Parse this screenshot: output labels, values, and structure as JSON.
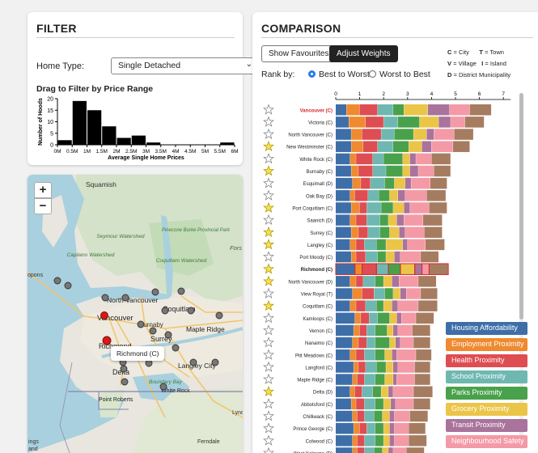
{
  "filter": {
    "title": "FILTER",
    "home_type_label": "Home Type:",
    "home_type_value": "Single Detached",
    "drag_label": "Drag to Filter by Price Range",
    "histogram": {
      "ylabel": "Number of Hoods",
      "xlabel": "Average Single Home Prices",
      "y_ticks": [
        "0",
        "5",
        "10",
        "15",
        "20"
      ],
      "x_ticks": [
        "0M",
        "0.5M",
        "1M",
        "1.5M",
        "2M",
        "2.5M",
        "3M",
        "3.5M",
        "4M",
        "4.5M",
        "5M",
        "5.5M",
        "6M"
      ],
      "counts": [
        2,
        19,
        15,
        8,
        3,
        4,
        1,
        0,
        0,
        0,
        0,
        1
      ]
    }
  },
  "map": {
    "zoom_in": "+",
    "zoom_out": "−",
    "tooltip": "Richmond (C)",
    "places": [
      {
        "name": "Squamish"
      },
      {
        "name": "North Vancouver"
      },
      {
        "name": "Vancouver"
      },
      {
        "name": "Coquitlam"
      },
      {
        "name": "Burnaby"
      },
      {
        "name": "Surrey"
      },
      {
        "name": "Maple Ridge"
      },
      {
        "name": "Richmond"
      },
      {
        "name": "Delta"
      },
      {
        "name": "Langley City"
      },
      {
        "name": "White Rock"
      },
      {
        "name": "Point Roberts"
      },
      {
        "name": "Lynde"
      },
      {
        "name": "Ferndale"
      },
      {
        "name": "Seymour Watershed"
      },
      {
        "name": "Pinecone Burke Provincial Park"
      },
      {
        "name": "Capilano Watershed"
      },
      {
        "name": "Coquitlam Watershed"
      },
      {
        "name": "Fors"
      },
      {
        "name": "opons"
      },
      {
        "name": "Boundary Bay"
      },
      {
        "name": "ings"
      },
      {
        "name": "and"
      }
    ]
  },
  "comparison": {
    "title": "COMPARISON",
    "show_favourites": "Show Favourites",
    "adjust_weights": "Adjust Weights",
    "keys": [
      {
        "code": "C",
        "text": " = City"
      },
      {
        "code": "T",
        "text": " = Town"
      },
      {
        "code": "V",
        "text": " = Village"
      },
      {
        "code": "I",
        "text": " = Island"
      },
      {
        "code": "D",
        "text": " = District Municipality"
      }
    ],
    "rank_by": "Rank by:",
    "best_to_worst": "Best to Worst",
    "worst_to_best": "Worst to Best",
    "axis_ticks": [
      "0",
      "1",
      "2",
      "3",
      "4",
      "5",
      "6",
      "7"
    ],
    "colors": {
      "housing": "#3e6ea8",
      "employment": "#ef8a30",
      "health": "#de4d52",
      "school": "#6fb8b1",
      "parks": "#4aa14b",
      "grocery": "#ebc548",
      "transit": "#a9739b",
      "safety": "#f49aa6",
      "other": "#a67c61"
    },
    "legend": [
      {
        "label": "Housing Affordability",
        "key": "housing"
      },
      {
        "label": "Employment Proximity",
        "key": "employment"
      },
      {
        "label": "Health Proximity",
        "key": "health"
      },
      {
        "label": "School Proximity",
        "key": "school"
      },
      {
        "label": "Parks Proximity",
        "key": "parks"
      },
      {
        "label": "Grocery Proximity",
        "key": "grocery"
      },
      {
        "label": "Transit Proximity",
        "key": "transit"
      },
      {
        "label": "Neighbourhood Safety",
        "key": "safety"
      }
    ]
  },
  "chart_data": {
    "type": "bar",
    "orientation": "horizontal-stacked",
    "xlim": [
      0,
      7.4
    ],
    "series_names": [
      "Housing Affordability",
      "Employment Proximity",
      "Health Proximity",
      "School Proximity",
      "Parks Proximity",
      "Grocery Proximity",
      "Transit Proximity",
      "Neighbourhood Safety",
      "Other"
    ],
    "rows": [
      {
        "name": "Vancouver (C)",
        "fav": false,
        "highlight": "red",
        "values": [
          0.45,
          0.55,
          0.75,
          0.65,
          0.45,
          1.0,
          0.9,
          0.85,
          0.9
        ]
      },
      {
        "name": "Victoria (C)",
        "fav": false,
        "values": [
          0.55,
          0.7,
          0.75,
          0.6,
          0.9,
          0.8,
          0.5,
          0.6,
          0.8
        ]
      },
      {
        "name": "North Vancouver (C)",
        "fav": false,
        "values": [
          0.65,
          0.45,
          0.8,
          0.55,
          0.8,
          0.55,
          0.3,
          0.85,
          0.8
        ]
      },
      {
        "name": "New Westminster (C)",
        "fav": true,
        "values": [
          0.65,
          0.5,
          0.6,
          0.65,
          0.65,
          0.55,
          0.4,
          0.9,
          0.7
        ]
      },
      {
        "name": "White Rock (C)",
        "fav": false,
        "values": [
          0.6,
          0.25,
          0.7,
          0.45,
          0.8,
          0.3,
          0.25,
          0.65,
          0.8
        ]
      },
      {
        "name": "Burnaby (C)",
        "fav": true,
        "values": [
          0.65,
          0.3,
          0.6,
          0.55,
          0.7,
          0.3,
          0.35,
          0.65,
          0.7
        ]
      },
      {
        "name": "Esquimalt (D)",
        "fav": false,
        "values": [
          0.7,
          0.35,
          0.4,
          0.6,
          0.4,
          0.45,
          0.25,
          0.8,
          0.7
        ]
      },
      {
        "name": "Oak Bay (D)",
        "fav": false,
        "values": [
          0.6,
          0.2,
          0.55,
          0.45,
          0.45,
          0.35,
          0.3,
          0.9,
          0.8
        ]
      },
      {
        "name": "Port Coquitlam (C)",
        "fav": true,
        "values": [
          0.65,
          0.35,
          0.3,
          0.6,
          0.5,
          0.45,
          0.25,
          0.8,
          0.75
        ]
      },
      {
        "name": "Saanich (D)",
        "fav": false,
        "values": [
          0.6,
          0.25,
          0.45,
          0.55,
          0.35,
          0.35,
          0.3,
          0.8,
          0.8
        ]
      },
      {
        "name": "Surrey (C)",
        "fav": true,
        "values": [
          0.65,
          0.3,
          0.4,
          0.5,
          0.4,
          0.4,
          0.25,
          0.8,
          0.75
        ]
      },
      {
        "name": "Langley (C)",
        "fav": true,
        "values": [
          0.6,
          0.25,
          0.35,
          0.5,
          0.4,
          0.7,
          0.2,
          0.75,
          0.8
        ]
      },
      {
        "name": "Port Moody (C)",
        "fav": false,
        "values": [
          0.65,
          0.2,
          0.4,
          0.5,
          0.35,
          0.35,
          0.25,
          0.85,
          0.75
        ]
      },
      {
        "name": "Richmond (C)",
        "fav": true,
        "bold": true,
        "values": [
          0.8,
          0.3,
          0.6,
          0.5,
          0.5,
          0.6,
          0.3,
          0.3,
          0.8
        ]
      },
      {
        "name": "North Vancouver (D)",
        "fav": true,
        "values": [
          0.6,
          0.25,
          0.3,
          0.5,
          0.35,
          0.35,
          0.3,
          0.8,
          0.75
        ]
      },
      {
        "name": "View Royal (T)",
        "fav": false,
        "values": [
          0.7,
          0.4,
          0.5,
          0.45,
          0.35,
          0.3,
          0.25,
          0.6,
          0.7
        ]
      },
      {
        "name": "Coquitlam (C)",
        "fav": true,
        "values": [
          0.6,
          0.25,
          0.4,
          0.45,
          0.3,
          0.35,
          0.25,
          0.85,
          0.8
        ]
      },
      {
        "name": "Kamloops (C)",
        "fav": false,
        "values": [
          0.8,
          0.25,
          0.35,
          0.35,
          0.5,
          0.3,
          0.2,
          0.6,
          0.75
        ]
      },
      {
        "name": "Vernon (C)",
        "fav": false,
        "values": [
          0.75,
          0.25,
          0.3,
          0.35,
          0.5,
          0.25,
          0.2,
          0.6,
          0.75
        ]
      },
      {
        "name": "Nanaimo (C)",
        "fav": false,
        "values": [
          0.7,
          0.25,
          0.35,
          0.35,
          0.6,
          0.25,
          0.2,
          0.55,
          0.7
        ]
      },
      {
        "name": "Pitt Meadows (C)",
        "fav": false,
        "values": [
          0.6,
          0.25,
          0.35,
          0.45,
          0.4,
          0.3,
          0.2,
          0.8,
          0.65
        ]
      },
      {
        "name": "Langford (C)",
        "fav": false,
        "values": [
          0.75,
          0.2,
          0.3,
          0.45,
          0.4,
          0.3,
          0.2,
          0.7,
          0.65
        ]
      },
      {
        "name": "Maple Ridge (C)",
        "fav": false,
        "values": [
          0.7,
          0.2,
          0.3,
          0.45,
          0.4,
          0.35,
          0.15,
          0.75,
          0.65
        ]
      },
      {
        "name": "Delta (D)",
        "fav": true,
        "values": [
          0.6,
          0.2,
          0.3,
          0.45,
          0.35,
          0.3,
          0.2,
          0.85,
          0.8
        ]
      },
      {
        "name": "Abbotsford (C)",
        "fav": false,
        "values": [
          0.65,
          0.2,
          0.35,
          0.45,
          0.35,
          0.3,
          0.2,
          0.75,
          0.7
        ]
      },
      {
        "name": "Chilliwack (C)",
        "fav": false,
        "values": [
          0.7,
          0.2,
          0.3,
          0.4,
          0.35,
          0.3,
          0.2,
          0.65,
          0.75
        ]
      },
      {
        "name": "Prince George (C)",
        "fav": false,
        "values": [
          0.75,
          0.25,
          0.3,
          0.35,
          0.35,
          0.25,
          0.2,
          0.6,
          0.7
        ]
      },
      {
        "name": "Colwood (C)",
        "fav": false,
        "values": [
          0.7,
          0.2,
          0.3,
          0.45,
          0.35,
          0.25,
          0.2,
          0.6,
          0.75
        ]
      },
      {
        "name": "West Kelowna (D)",
        "fav": false,
        "values": [
          0.7,
          0.2,
          0.3,
          0.4,
          0.35,
          0.25,
          0.2,
          0.55,
          0.75
        ]
      }
    ]
  }
}
